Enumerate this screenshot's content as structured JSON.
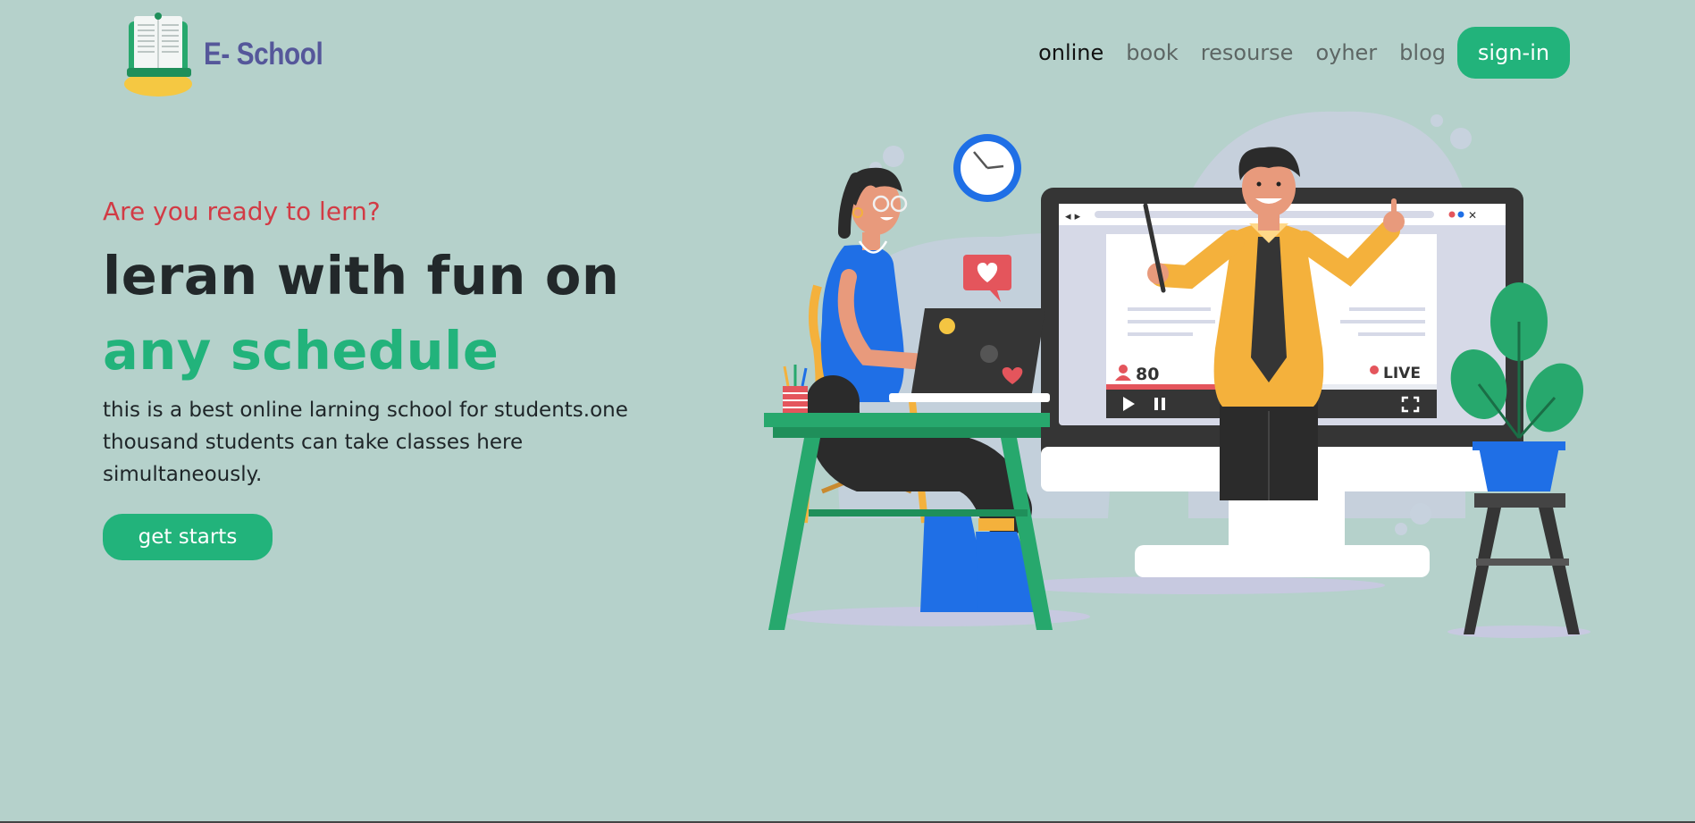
{
  "colors": {
    "background": "#b5d1cb",
    "accent": "#22b37b",
    "tagline": "#d23b45",
    "logo_text": "#55579a"
  },
  "header": {
    "logo": {
      "icon": "book-logo-icon",
      "text": "E- School"
    },
    "nav": [
      {
        "label": "online",
        "active": true
      },
      {
        "label": "book",
        "active": false
      },
      {
        "label": "resourse",
        "active": false
      },
      {
        "label": "oyher",
        "active": false
      },
      {
        "label": "blog",
        "active": false
      }
    ],
    "sign_in_label": "sign-in"
  },
  "hero": {
    "tagline": "Are you ready to lern?",
    "headline_line1": "leran with fun on",
    "headline_line2": "any schedule",
    "description": "this is a best online larning school for students.one thousand students can take classes here simultaneously.",
    "cta_label": "get starts"
  },
  "illustration": {
    "viewer_count": "80",
    "live_label": "LIVE"
  }
}
